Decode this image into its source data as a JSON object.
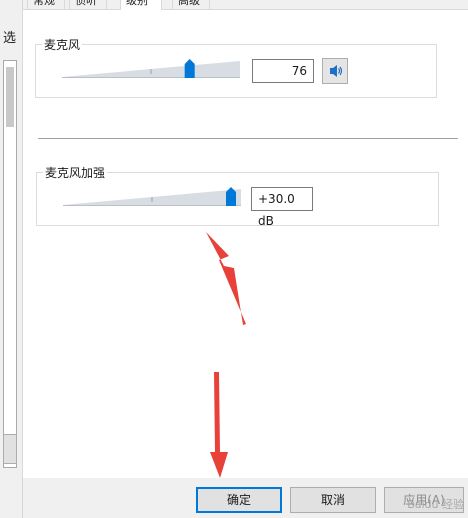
{
  "background_dialog": {
    "label": "选"
  },
  "tabs": [
    {
      "label": "常规",
      "active": false
    },
    {
      "label": "侦听",
      "active": false
    },
    {
      "label": "级别",
      "active": true
    },
    {
      "label": "高级",
      "active": false
    }
  ],
  "microphone": {
    "title": "麦克风",
    "level": 76,
    "level_text": "76",
    "max": 100,
    "speaker_icon": "speaker-icon"
  },
  "boost": {
    "title": "麦克风加强",
    "value_text": "+30.0 dB",
    "level_fraction": 1.0
  },
  "footer": {
    "ok_label": "确定",
    "cancel_label": "取消",
    "apply_label": "应用(A)"
  },
  "accent_color": "#0078d7",
  "annotation_color": "#e8413a",
  "watermark": "Baidu 经验"
}
